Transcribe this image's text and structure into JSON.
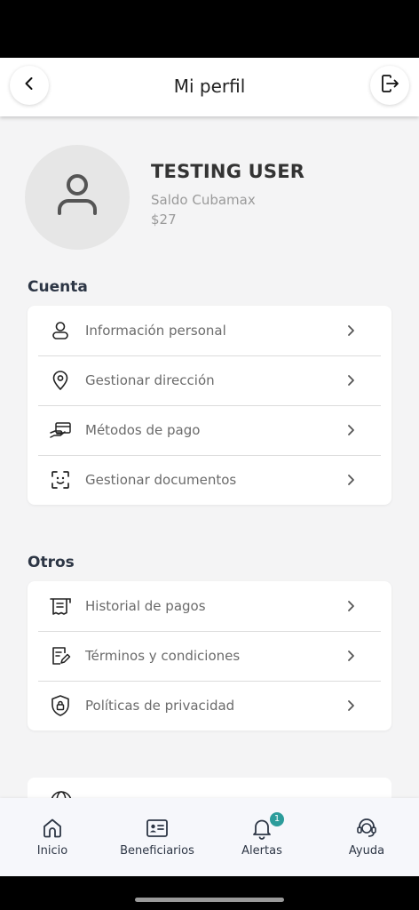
{
  "header": {
    "title": "Mi perfil"
  },
  "profile": {
    "name": "TESTING USER",
    "balance_label": "Saldo Cubamax",
    "balance_value": "$27"
  },
  "sections": {
    "cuenta": {
      "title": "Cuenta",
      "items": [
        {
          "label": "Información personal",
          "icon": "person-icon"
        },
        {
          "label": "Gestionar dirección",
          "icon": "location-pin-icon"
        },
        {
          "label": "Métodos de pago",
          "icon": "payment-card-icon"
        },
        {
          "label": "Gestionar documentos",
          "icon": "face-scan-icon"
        }
      ]
    },
    "otros": {
      "title": "Otros",
      "items": [
        {
          "label": "Historial de pagos",
          "icon": "receipt-icon"
        },
        {
          "label": "Términos y condiciones",
          "icon": "document-edit-icon"
        },
        {
          "label": "Políticas de privacidad",
          "icon": "shield-lock-icon"
        }
      ]
    }
  },
  "bottom_nav": {
    "items": [
      {
        "label": "Inicio",
        "icon": "home-icon"
      },
      {
        "label": "Beneficiarios",
        "icon": "id-card-icon"
      },
      {
        "label": "Alertas",
        "icon": "bell-icon",
        "badge": "1"
      },
      {
        "label": "Ayuda",
        "icon": "support-agent-icon"
      }
    ]
  },
  "colors": {
    "background": "#f4f4f5",
    "section_title": "#2d3645",
    "badge": "#2c9c9b"
  }
}
